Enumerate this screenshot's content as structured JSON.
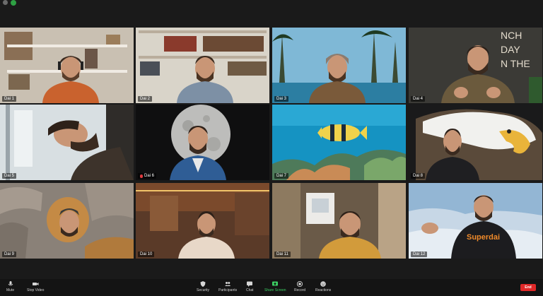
{
  "window": {
    "status_color": "#2ea043"
  },
  "tiles": [
    {
      "label": "Dai 1",
      "muted": false
    },
    {
      "label": "Dai 2",
      "muted": false
    },
    {
      "label": "Dai 3",
      "muted": false
    },
    {
      "label": "Dai 4",
      "muted": false
    },
    {
      "label": "Dai 5",
      "muted": false
    },
    {
      "label": "Dai 6",
      "muted": true
    },
    {
      "label": "Dai 7",
      "muted": false
    },
    {
      "label": "Dai 8",
      "muted": false
    },
    {
      "label": "Dai 9",
      "muted": false,
      "active_speaker": true
    },
    {
      "label": "Dai 10",
      "muted": false
    },
    {
      "label": "Dai 11",
      "muted": false
    },
    {
      "label": "Dai 12",
      "muted": false
    }
  ],
  "tile_text": {
    "tile4_wall_text": "NCH\nDAY\nN THE\n-",
    "tile12_shirt_text": "Superdai"
  },
  "toolbar": {
    "mute": "Mute",
    "stop_video": "Stop Video",
    "security": "Security",
    "participants": "Participants",
    "chat": "Chat",
    "share_screen": "Share Screen",
    "record": "Record",
    "reactions": "Reactions",
    "end": "End"
  },
  "colors": {
    "active_speaker_border": "#c9e24a",
    "share_screen": "#3ccf63",
    "end_button": "#e02828"
  }
}
